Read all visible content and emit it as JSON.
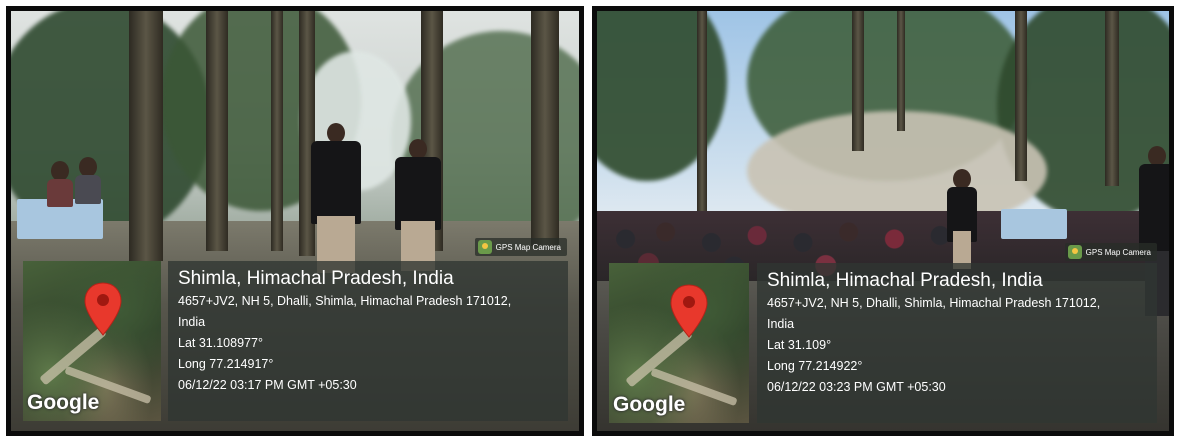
{
  "photos": [
    {
      "badge": "GPS Map Camera",
      "map_mark": "Google",
      "pin_icon": "map-pin-icon",
      "pin_color": "#e8382c",
      "title": "Shimla, Himachal Pradesh, India",
      "address": "4657+JV2, NH 5, Dhalli, Shimla, Himachal Pradesh 171012, India",
      "lat": "Lat 31.108977°",
      "long": "Long 77.214917°",
      "datetime": "06/12/22 03:17 PM GMT +05:30"
    },
    {
      "badge": "GPS Map Camera",
      "map_mark": "Google",
      "pin_icon": "map-pin-icon",
      "pin_color": "#e8382c",
      "title": "Shimla, Himachal Pradesh, India",
      "address": "4657+JV2, NH 5, Dhalli, Shimla, Himachal Pradesh 171012, India",
      "lat": "Lat 31.109°",
      "long": "Long 77.214922°",
      "datetime": "06/12/22 03:23 PM GMT +05:30"
    }
  ]
}
